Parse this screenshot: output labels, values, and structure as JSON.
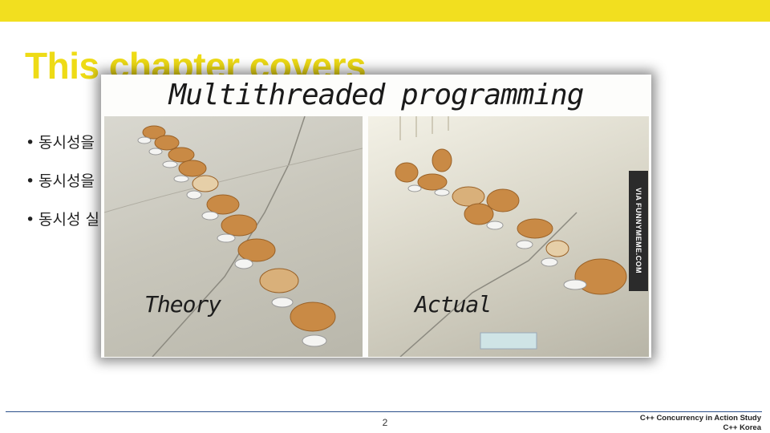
{
  "slide": {
    "title": "This chapter covers",
    "bullets": [
      {
        "marker": "•",
        "text": "동시성을"
      },
      {
        "marker": "•",
        "text": "동시성을"
      },
      {
        "marker": "•",
        "text": "동시성  실"
      }
    ]
  },
  "meme": {
    "caption": "Multithreaded programming",
    "left_label": "Theory",
    "right_label": "Actual",
    "watermark": "VIA FUNNYMEME.COM"
  },
  "footer": {
    "page_number": "2",
    "line1": "C++ Concurrency in Action Study",
    "line2": "C++ Korea"
  },
  "colors": {
    "accent_yellow": "#f2df1f",
    "title_yellow": "#eedb16",
    "footer_line": "#2a4f8a"
  }
}
